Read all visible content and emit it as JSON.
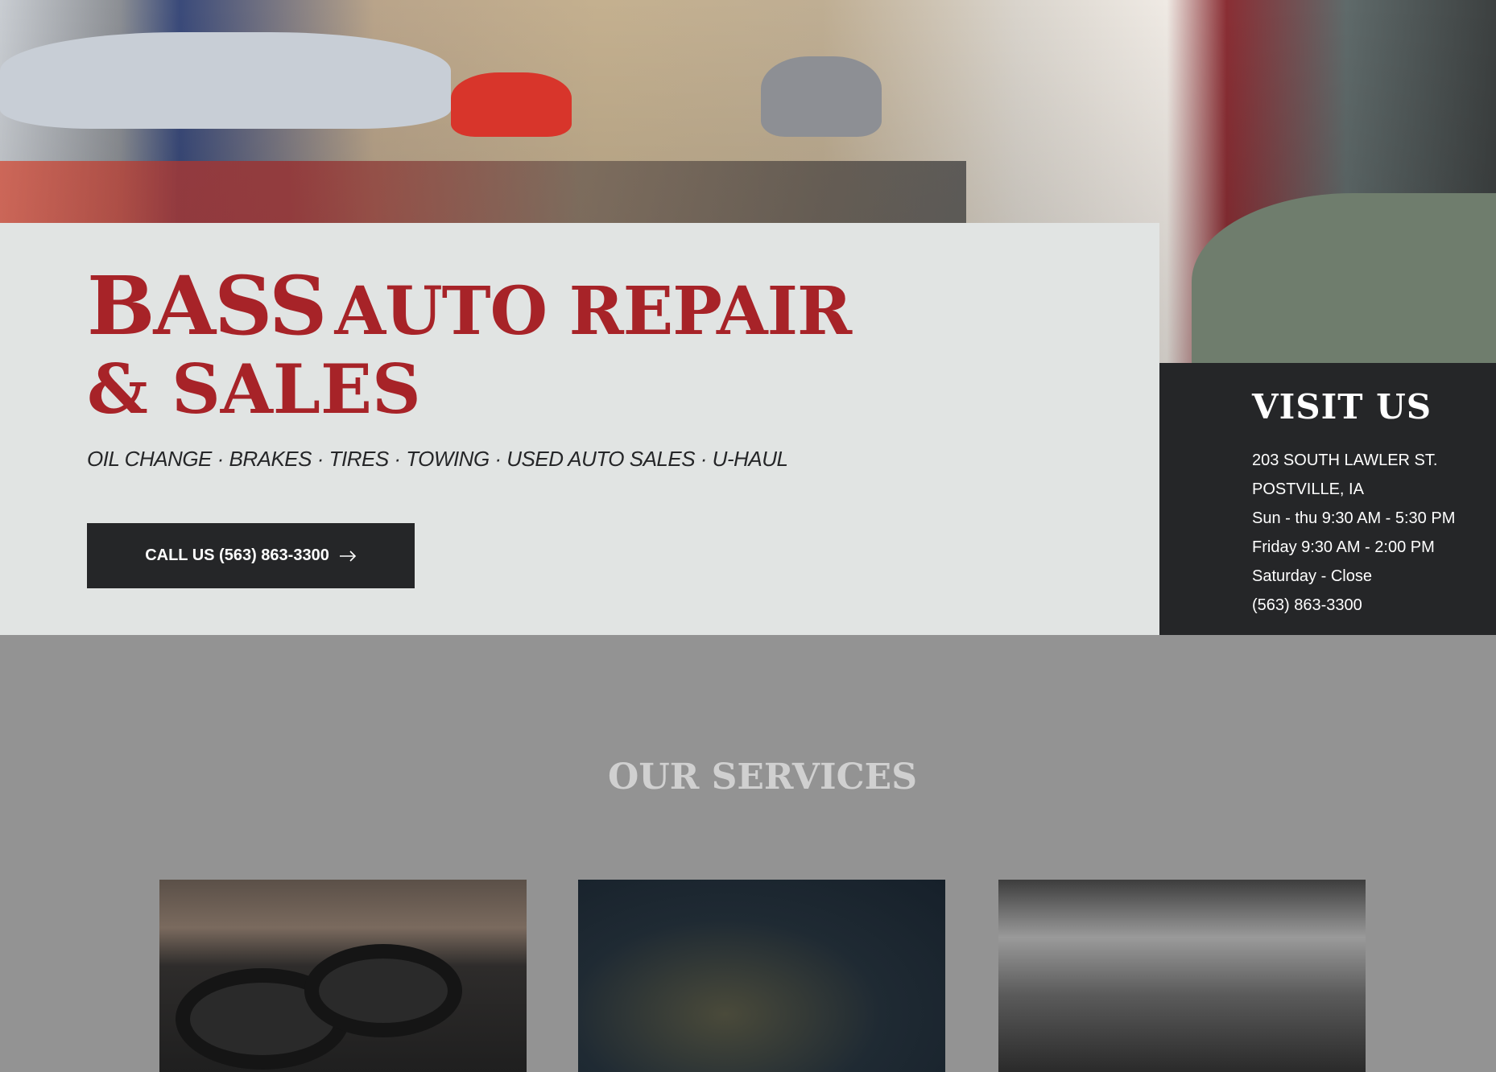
{
  "hero": {
    "title_line1_big": "BASS",
    "title_line1_rest": "AUTO REPAIR",
    "title_line2": "& SALES",
    "tagline": "OIL CHANGE ·  BRAKES · TIRES · TOWING · USED AUTO SALES · U-HAUL",
    "cta_label": "CALL US (563) 863-3300",
    "cta_icon": "arrow-right-icon"
  },
  "visit": {
    "title": "VISIT US",
    "lines": [
      "203 SOUTH LAWLER ST.",
      "POSTVILLE, IA",
      "Sun - thu 9:30 AM - 5:30 PM",
      "Friday 9:30 AM - 2:00 PM",
      "Saturday - Close",
      "(563) 863-3300"
    ]
  },
  "services": {
    "title": "OUR SERVICES"
  },
  "colors": {
    "brand_red": "#a72328",
    "dark": "#252628",
    "light_panel": "#e1e4e3",
    "section_gray": "#939393"
  }
}
